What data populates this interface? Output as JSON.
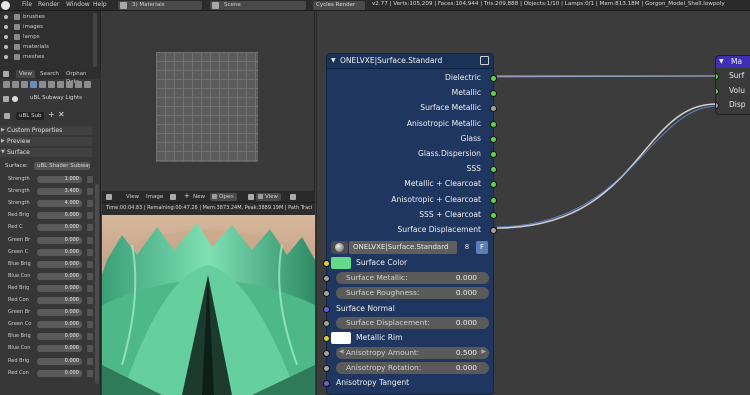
{
  "topbar": {
    "menus": [
      "File",
      "Render",
      "Window",
      "Help"
    ],
    "layout": "3) Materials",
    "scene": "Scene",
    "engine": "Cycles Render",
    "stats": "v2.77 | Verts:105,209 | Faces:104,944 | Tris:209,888 | Objects:1/10 | Lamps:0/1 | Mem:813.18M | Gorgon_Model_Shell.lowpoly"
  },
  "outliner": {
    "items": [
      "brushes",
      "images",
      "lamps",
      "materials",
      "meshes"
    ]
  },
  "properties": {
    "tabs": [
      "View",
      "Search",
      "Orphan Data"
    ],
    "world_name": "uBL Subway Lights",
    "world_field": "uBL Sub",
    "panels": {
      "custom_properties": "Custom Properties",
      "preview": "Preview",
      "surface": "Surface"
    },
    "surface_label": "Surface:",
    "surface_value": "uBL Shader Subway",
    "rows": [
      {
        "label": "Strength",
        "value": "1.000"
      },
      {
        "label": "Strength",
        "value": "3.400"
      },
      {
        "label": "Strength",
        "value": "4.000"
      },
      {
        "label": "Red Brig",
        "value": "0.000"
      },
      {
        "label": "Red C",
        "value": "0.000"
      },
      {
        "label": "Green Br",
        "value": "0.000"
      },
      {
        "label": "Green C",
        "value": "0.000"
      },
      {
        "label": "Blue Brig",
        "value": "0.000"
      },
      {
        "label": "Blue Con",
        "value": "0.000"
      },
      {
        "label": "Red Brig",
        "value": "0.000"
      },
      {
        "label": "Red Con",
        "value": "0.000"
      },
      {
        "label": "Green Br",
        "value": "0.000"
      },
      {
        "label": "Green Co",
        "value": "0.000"
      },
      {
        "label": "Blue Brig",
        "value": "0.000"
      },
      {
        "label": "Blue Con",
        "value": "0.000"
      },
      {
        "label": "Red Brig",
        "value": "0.000"
      },
      {
        "label": "Red Con",
        "value": "0.000"
      }
    ]
  },
  "image_editor": {
    "menus": [
      "View",
      "Image"
    ],
    "new_label": "New",
    "open_label": "Open",
    "view_label": "View",
    "info": "Time:00:04.83 | Remaining:00:47.26 | Mem:3873.24M, Peak:3889.19M | Path Traci"
  },
  "node_main": {
    "title": "ONELVXE|Surface.Standard",
    "outputs": [
      {
        "label": "Dielectric",
        "socket": "green"
      },
      {
        "label": "Metallic",
        "socket": "green"
      },
      {
        "label": "Surface Metallic",
        "socket": "grey"
      },
      {
        "label": "Anisotropic Metallic",
        "socket": "green"
      },
      {
        "label": "Glass",
        "socket": "green"
      },
      {
        "label": "Glass.Dispersion",
        "socket": "green"
      },
      {
        "label": "SSS",
        "socket": "green"
      },
      {
        "label": "Metallic + Clearcoat",
        "socket": "green"
      },
      {
        "label": "Anisotropic + Clearcoat",
        "socket": "green"
      },
      {
        "label": "SSS + Clearcoat",
        "socket": "green"
      },
      {
        "label": "Surface Displacement",
        "socket": "grey"
      }
    ],
    "group_name": "ONELVXE|Surface.Standard",
    "group_users": "8",
    "fake_user": "F",
    "inputs": {
      "surface_color": "Surface Color",
      "surface_color_value": "#63d98c",
      "surface_metallic": {
        "label": "Surface Metallic:",
        "value": "0.000"
      },
      "surface_roughness": {
        "label": "Surface Roughness:",
        "value": "0.000"
      },
      "surface_normal": "Surface Normal",
      "surface_displacement": {
        "label": "Surface Displacement:",
        "value": "0.000"
      },
      "metallic_rim": "Metallic Rim",
      "metallic_rim_value": "#ffffff",
      "anisotropy_amount": {
        "label": "Anisotropy Amount:",
        "value": "0.500"
      },
      "anisotropy_rotation": {
        "label": "Anisotropy Rotation:",
        "value": "0.000"
      },
      "anisotropy_tangent": "Anisotropy Tangent"
    }
  },
  "node_material": {
    "title": "Ma",
    "inputs": [
      "Surf",
      "Volu",
      "Disp"
    ]
  },
  "colors": {
    "node_body": "#1e3660",
    "socket_green": "#5fd44a",
    "socket_grey": "#a2a2a2",
    "material_header": "#3e2fb5",
    "render_green": "#5cc596"
  }
}
